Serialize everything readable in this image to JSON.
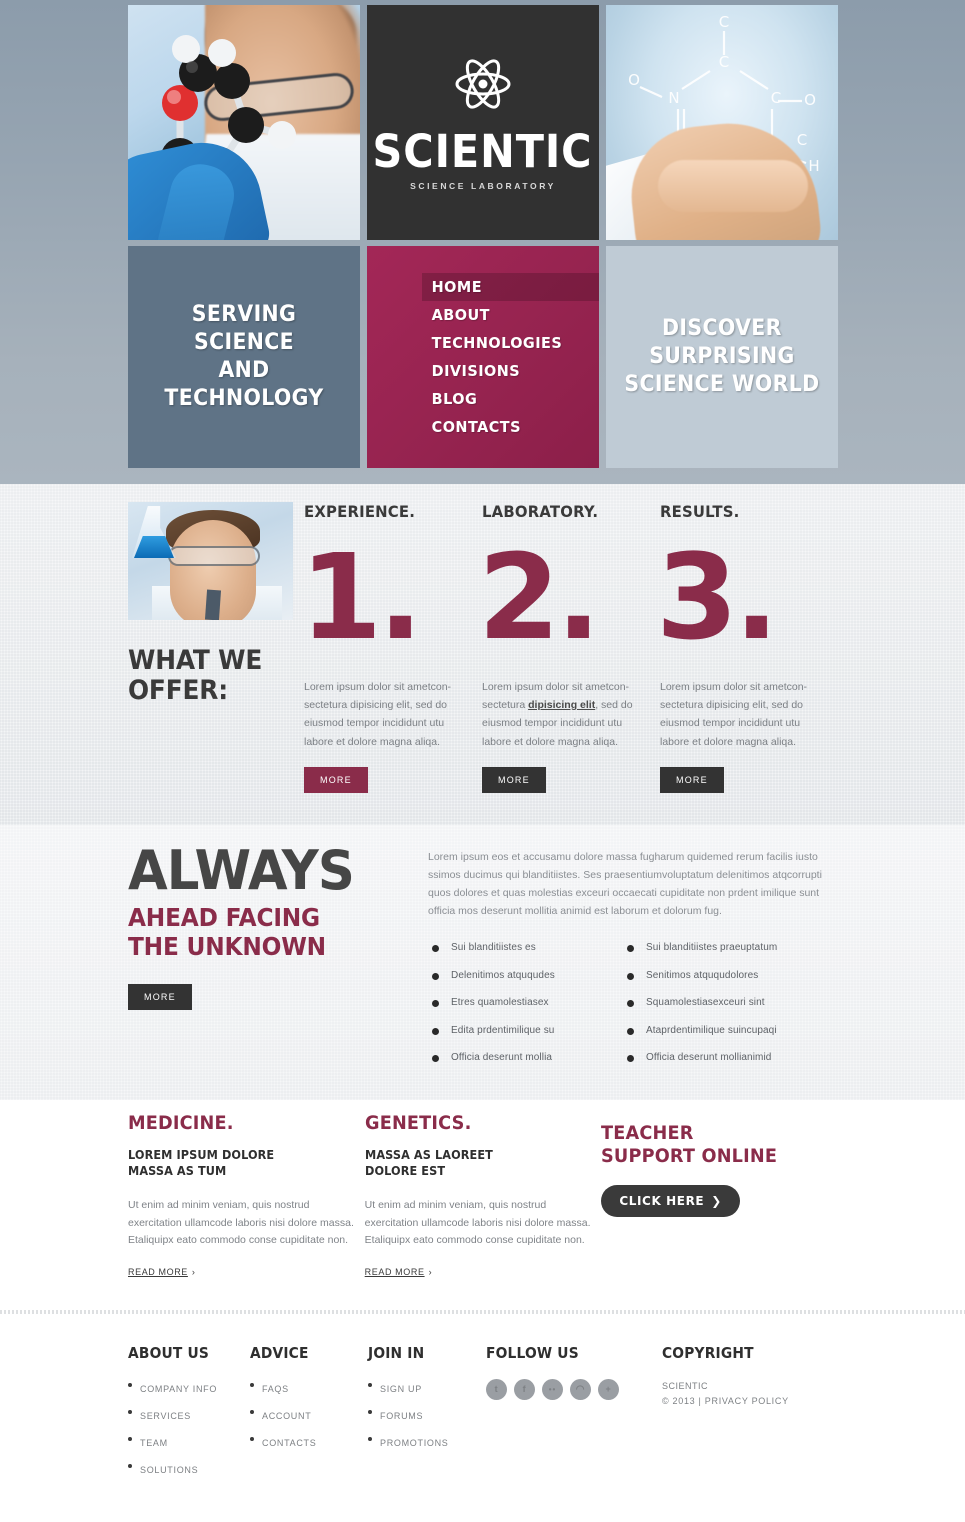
{
  "header": {
    "logo": {
      "title": "SCIENTIC",
      "subtitle": "SCIENCE LABORATORY",
      "icon": "atom-icon"
    },
    "tile_left_slogan": "SERVING\nSCIENCE\nAND TECHNOLOGY",
    "tile_right_slogan": "DISCOVER\nSURPRISING\nSCIENCE WORLD",
    "nav": [
      {
        "label": "HOME",
        "active": true
      },
      {
        "label": "ABOUT",
        "active": false
      },
      {
        "label": "TECHNOLOGIES",
        "active": false
      },
      {
        "label": "DIVISIONS",
        "active": false
      },
      {
        "label": "BLOG",
        "active": false
      },
      {
        "label": "CONTACTS",
        "active": false
      }
    ]
  },
  "offer": {
    "title": "WHAT WE\nOFFER:",
    "items": [
      {
        "head": "EXPERIENCE.",
        "number": "1.",
        "text_before": "Lorem ipsum dolor sit ametcon-sectetura dipisicing elit, sed do eiusmod tempor incididunt utu labore et dolore magna aliqa.",
        "link": "",
        "text_after": "",
        "button": "MORE",
        "button_style": "accent"
      },
      {
        "head": "LABORATORY.",
        "number": "2.",
        "text_before": "Lorem ipsum dolor sit ametcon-sectetura ",
        "link": "dipisicing elit",
        "text_after": ", sed do eiusmod tempor incididunt utu labore et dolore magna aliqa.",
        "button": "MORE",
        "button_style": "dark"
      },
      {
        "head": "RESULTS.",
        "number": "3.",
        "text_before": "Lorem ipsum dolor sit ametcon-sectetura dipisicing elit, sed do eiusmod tempor incididunt utu labore et dolore magna aliqa.",
        "link": "",
        "text_after": "",
        "button": "MORE",
        "button_style": "dark"
      }
    ]
  },
  "always": {
    "heading_main": "ALWAYS",
    "heading_sub": "AHEAD FACING\nTHE UNKNOWN",
    "button": "MORE",
    "paragraph": "Lorem ipsum eos et accusamu dolore massa fugharum quidemed rerum facilis iusto ssimos ducimus qui blanditiistes. Ses praesentiumvoluptatum delenitimos atqcorrupti quos dolores et quas molestias exceuri occaecati cupiditate non prdent imilique sunt officia mos deserunt mollitia animid est laborum et dolorum fug.",
    "list_left": [
      "Sui blanditiistes es",
      "Delenitimos atququdes",
      "Etres quamolestiasex",
      "Edita prdentimilique su",
      "Officia deserunt mollia"
    ],
    "list_right": [
      "Sui blanditiistes praeuptatum",
      "Senitimos atququdolores",
      "Squamolestiasexceuri sint",
      "Ataprdentimilique suincupaqi",
      "Officia deserunt mollianimid"
    ]
  },
  "columns": [
    {
      "heading": "MEDICINE.",
      "subheading": "LOREM IPSUM DOLORE\nMASSA AS TUM",
      "text": "Ut enim ad minim veniam, quis nostrud exercitation ullamcode laboris nisi dolore massa. Etaliquipx eato commodo conse cupiditate non.",
      "link": "READ MORE",
      "arrow": "›"
    },
    {
      "heading": "GENETICS.",
      "subheading": "MASSA AS LAOREET\nDOLORE EST",
      "text": "Ut enim ad minim veniam, quis nostrud exercitation ullamcode laboris nisi dolore massa. Etaliquipx eato commodo conse cupiditate non.",
      "link": "READ MORE",
      "arrow": "›"
    }
  ],
  "teacher": {
    "heading": "TEACHER\nSUPPORT ONLINE",
    "button": "CLICK HERE",
    "button_arrow": "❯"
  },
  "footer": {
    "columns": [
      {
        "heading": "ABOUT US",
        "items": [
          "COMPANY INFO",
          "SERVICES",
          "TEAM",
          "SOLUTIONS"
        ]
      },
      {
        "heading": "ADVICE",
        "items": [
          "FAQS",
          "ACCOUNT",
          "CONTACTS"
        ]
      },
      {
        "heading": "JOIN IN",
        "items": [
          "SIGN UP",
          "FORUMS",
          "PROMOTIONS"
        ]
      }
    ],
    "follow": {
      "heading": "FOLLOW US",
      "icons": [
        {
          "name": "twitter-icon",
          "glyph": "t"
        },
        {
          "name": "facebook-icon",
          "glyph": "f"
        },
        {
          "name": "flickr-icon",
          "glyph": "••"
        },
        {
          "name": "rss-icon",
          "glyph": "◠"
        },
        {
          "name": "share-plus-icon",
          "glyph": "+"
        }
      ]
    },
    "copyright": {
      "heading": "COPYRIGHT",
      "brand": "SCIENTIC",
      "line": "© 2013 | PRIVACY POLICY"
    }
  },
  "colors": {
    "accent_maroon": "#8a2c4a",
    "dark": "#333333",
    "header_slate": "#5f7386",
    "header_light": "#bfcbd5",
    "logo_bg": "#313131",
    "nav_bg": "#a3245a"
  }
}
